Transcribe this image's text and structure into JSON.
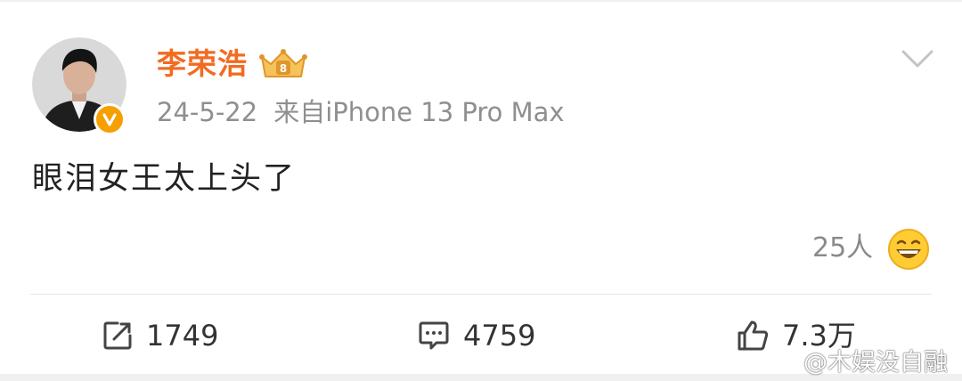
{
  "post": {
    "author": "李荣浩",
    "date": "24-5-22",
    "source": "来自iPhone 13 Pro Max",
    "text": "眼泪女王太上头了",
    "reactions": {
      "count_label": "25人",
      "emoji": "grinning-face-emoji"
    }
  },
  "actions": {
    "share_count": "1749",
    "comment_count": "4759",
    "like_count": "7.3万"
  },
  "watermark": "@木娱没自融",
  "colors": {
    "username": "#f26b21",
    "meta": "#8f8f8f",
    "verified_badge": "#f5a000",
    "text": "#222222"
  }
}
